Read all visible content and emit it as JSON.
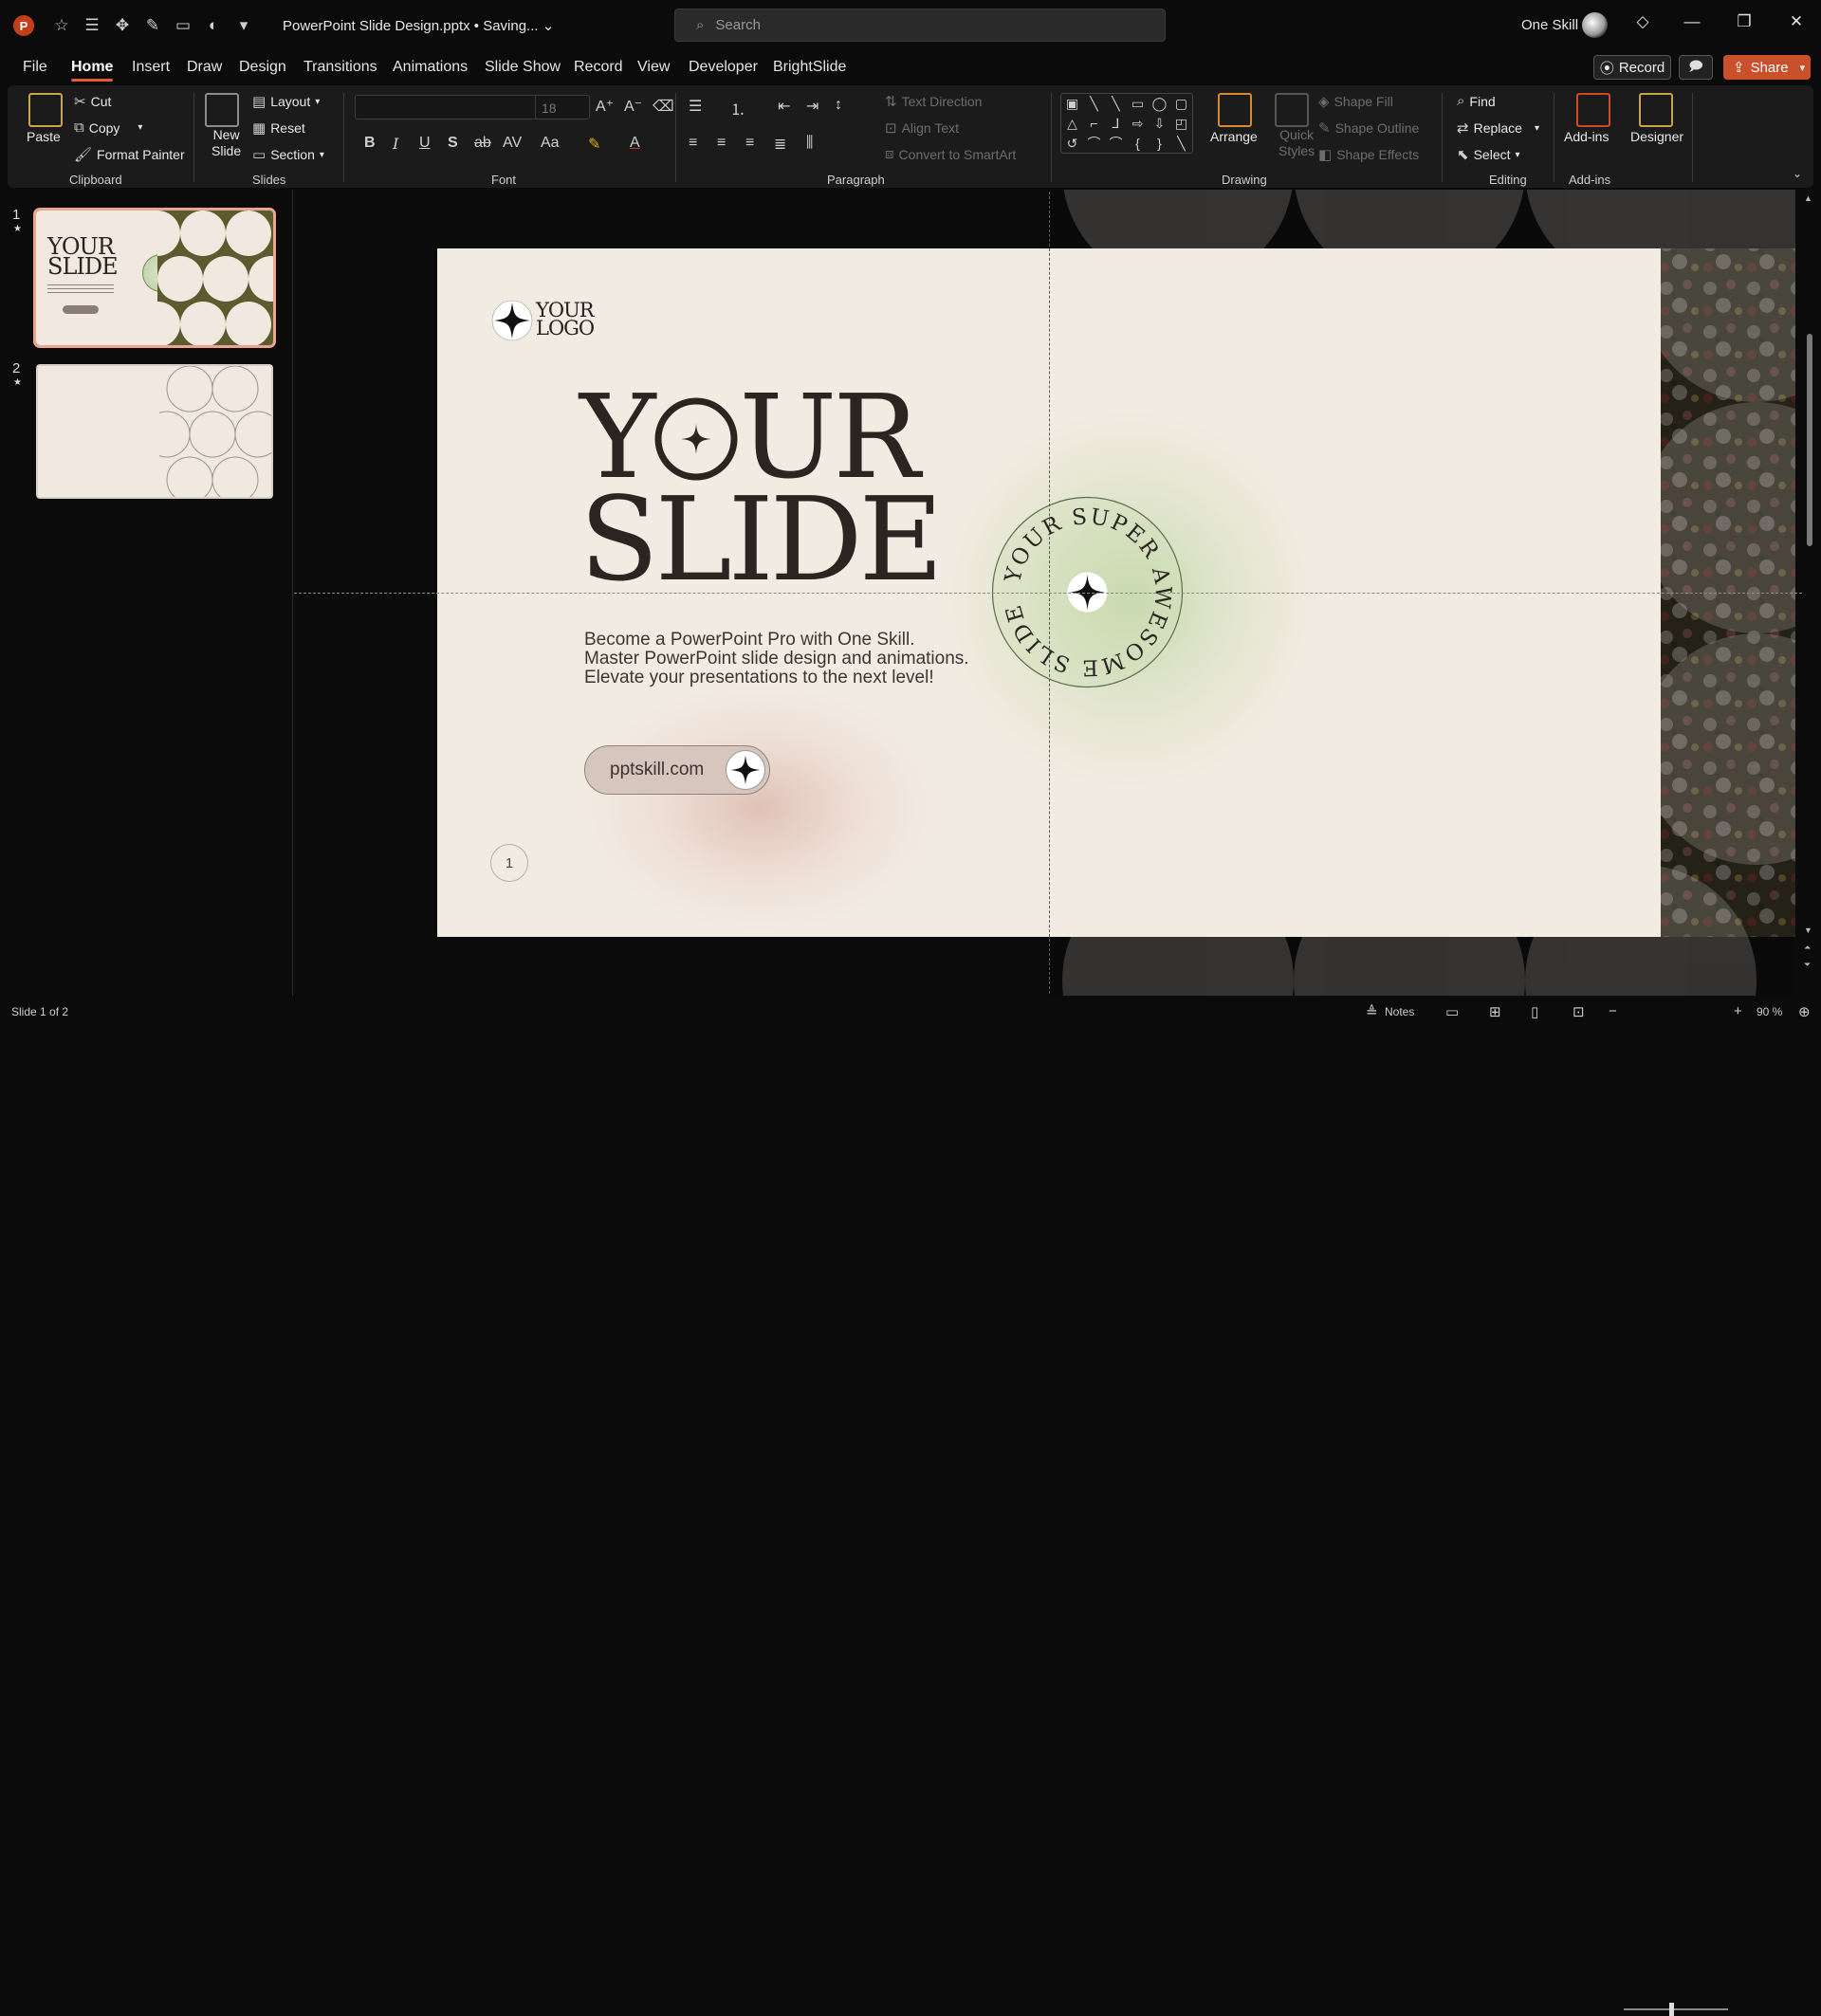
{
  "app": {
    "logo_letter": "P",
    "document_title": "PowerPoint Slide Design.pptx • Saving...",
    "search_placeholder": "Search",
    "user_name": "One Skill",
    "colors": {
      "accent": "#e05a35",
      "share": "#c9502b",
      "app_logo": "#c43e1c"
    }
  },
  "quick_access": [
    "star-icon",
    "list-icon",
    "move-icon",
    "pen-icon",
    "presenter-icon",
    "circle-icon",
    "customize-icon"
  ],
  "menu": {
    "tabs": [
      "File",
      "Home",
      "Insert",
      "Draw",
      "Design",
      "Transitions",
      "Animations",
      "Slide Show",
      "Record",
      "View",
      "Developer",
      "BrightSlide"
    ],
    "active": "Home",
    "record_label": "Record",
    "share_label": "Share"
  },
  "ribbon": {
    "clipboard": {
      "label": "Clipboard",
      "paste": "Paste",
      "cut": "Cut",
      "copy": "Copy",
      "format_painter": "Format Painter"
    },
    "slides": {
      "label": "Slides",
      "new_slide": "New",
      "new_slide_2": "Slide",
      "layout": "Layout",
      "reset": "Reset",
      "section": "Section"
    },
    "font": {
      "label": "Font",
      "font_name": "",
      "font_size": "18"
    },
    "paragraph": {
      "label": "Paragraph",
      "text_direction": "Text Direction",
      "align_text": "Align Text",
      "convert_smartart": "Convert to SmartArt"
    },
    "drawing": {
      "label": "Drawing",
      "arrange": "Arrange",
      "quick_styles": "Quick",
      "quick_styles_2": "Styles",
      "shape_fill": "Shape Fill",
      "shape_outline": "Shape Outline",
      "shape_effects": "Shape Effects"
    },
    "editing": {
      "label": "Editing",
      "find": "Find",
      "replace": "Replace",
      "select": "Select"
    },
    "addins": {
      "label": "Add-ins",
      "addins": "Add-ins",
      "designer": "Designer"
    }
  },
  "thumbnails": [
    {
      "number": "1",
      "selected": true,
      "title_line1": "YOUR",
      "title_line2": "SLIDE"
    },
    {
      "number": "2",
      "selected": false
    }
  ],
  "slide": {
    "logo_line1": "YOUR",
    "logo_line2": "LOGO",
    "title_line1_a": "Y",
    "title_line1_b": "UR",
    "title_line2": "SLIDE",
    "body": "Become a PowerPoint Pro with One Skill. Master PowerPoint slide design and animations. Elevate your presentations to the next level!",
    "pill_text": "pptskill.com",
    "badge_text": "YOUR SUPER AWESOME SLIDE *",
    "page_number": "1",
    "colors": {
      "background": "#f2ebe2",
      "title": "#2a2521",
      "pill": "#d6c6bd",
      "green_glow": "#bed7a5"
    }
  },
  "status": {
    "slide_info": "Slide 1 of 2",
    "notes": "Notes",
    "zoom": "90 %"
  }
}
